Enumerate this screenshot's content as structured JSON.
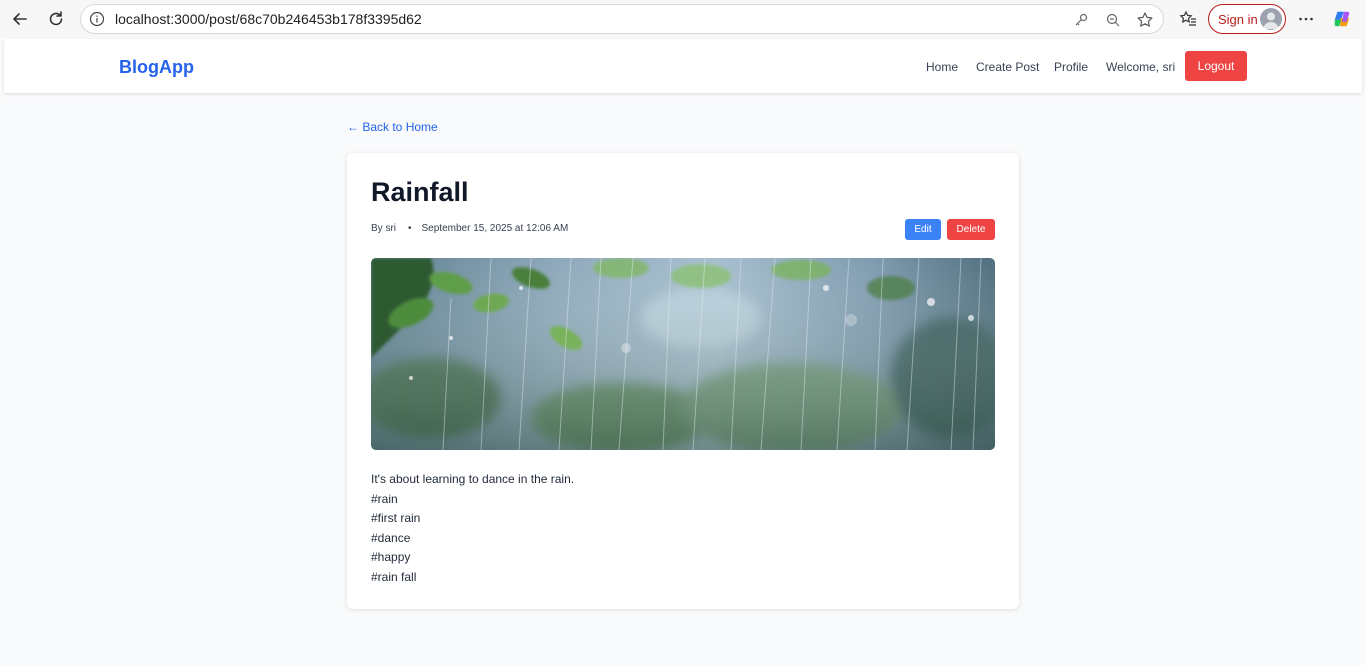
{
  "browser": {
    "url": "localhost:3000/post/68c70b246453b178f3395d62",
    "sign_in_label": "Sign in"
  },
  "header": {
    "brand": "BlogApp",
    "nav": {
      "home": "Home",
      "create_post": "Create Post",
      "profile": "Profile",
      "welcome": "Welcome, sri"
    },
    "logout_label": "Logout"
  },
  "back_link": "← Back to Home",
  "post": {
    "title": "Rainfall",
    "author": "By sri",
    "separator": "•",
    "date": "September 15, 2025 at 12:06 AM",
    "edit_label": "Edit",
    "delete_label": "Delete",
    "body_lines": [
      "It's about learning to dance in the rain.",
      "#rain",
      "#first rain",
      "#dance",
      "#happy",
      "#rain fall"
    ]
  },
  "colors": {
    "brand": "#2563eb",
    "danger": "#ef4444",
    "primary": "#3b82f6",
    "page_bg": "#f9fafb"
  }
}
